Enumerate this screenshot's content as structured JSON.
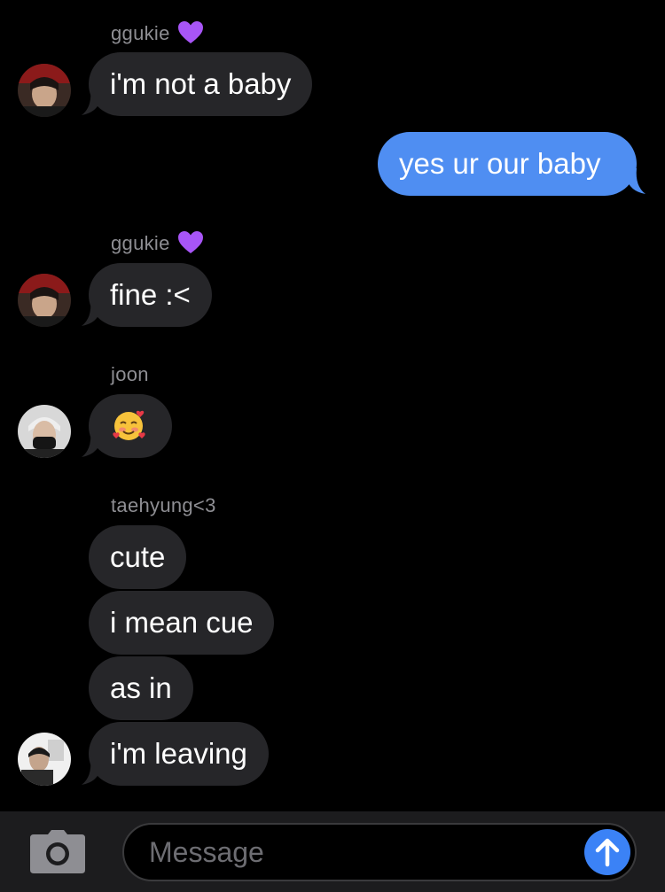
{
  "thread": {
    "messages": [
      {
        "sender": "ggukie",
        "text": "i'm not a baby"
      },
      {
        "sender": "me",
        "text": "yes ur our baby"
      },
      {
        "sender": "ggukie",
        "text": "fine :<"
      },
      {
        "sender": "joon",
        "emoji": "smiling-face-with-hearts"
      },
      {
        "sender": "taehyung<3",
        "text": "cute"
      },
      {
        "sender": "taehyung<3",
        "text": "i mean cue"
      },
      {
        "sender": "taehyung<3",
        "text": "as in"
      },
      {
        "sender": "taehyung<3",
        "text": "i'm leaving"
      }
    ],
    "names": {
      "ggukie": "ggukie",
      "joon": "joon",
      "taehyung": "taehyung<3"
    }
  },
  "composer": {
    "placeholder": "Message",
    "camera_icon": "camera-icon",
    "send_icon": "arrow-up-icon"
  },
  "colors": {
    "background": "#000000",
    "incoming_bubble": "#262629",
    "outgoing_bubble": "#4f8ef2",
    "send_button": "#3b82f6",
    "name_label": "#8e8e93",
    "heart": "#a855f7"
  }
}
